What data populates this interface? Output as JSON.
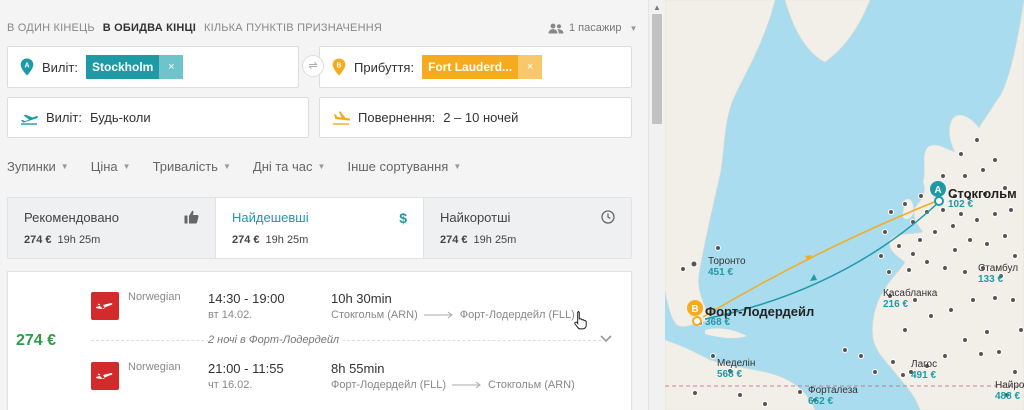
{
  "search": {
    "trip_types": [
      "В ОДИН КІНЕЦЬ",
      "В ОБИДВА КІНЦІ",
      "КІЛЬКА ПУНКТІВ ПРИЗНАЧЕННЯ"
    ],
    "passengers": "1 пасажир",
    "from_label": "Виліт:",
    "from_value": "Stockholm",
    "to_label": "Прибуття:",
    "to_value": "Fort Lauderd...",
    "depart_label": "Виліт:",
    "depart_value": "Будь-коли",
    "return_label": "Повернення:",
    "return_value": "2 – 10 ночей",
    "swap_icon": "⇌",
    "remove_icon": "×"
  },
  "filters": [
    "Зупинки",
    "Ціна",
    "Тривалість",
    "Дні та час",
    "Інше сортування"
  ],
  "sort_tabs": [
    {
      "name": "Рекомендовано",
      "price": "274 €",
      "duration": "19h 25m",
      "icon": "thumbs-up-icon"
    },
    {
      "name": "Найдешевші",
      "price": "274 €",
      "duration": "19h 25m",
      "icon": "dollar-icon"
    },
    {
      "name": "Найкоротші",
      "price": "274 €",
      "duration": "19h 25m",
      "icon": "clock-icon"
    }
  ],
  "result": {
    "price": "274 €",
    "outbound": {
      "airline": "Norwegian",
      "times": "14:30 - 19:00",
      "date": "вт 14.02.",
      "duration": "10h 30min",
      "from": "Стокгольм (ARN)",
      "to": "Форт-Лодердейл (FLL)"
    },
    "stay": "2 ночі в Форт-Лодердейл",
    "inbound": {
      "airline": "Norwegian",
      "times": "21:00 - 11:55",
      "date": "чт 16.02.",
      "duration": "8h 55min",
      "from": "Форт-Лодердейл (FLL)",
      "to": "Стокгольм (ARN)"
    }
  },
  "map": {
    "cities": [
      {
        "name": "Стокгольм",
        "price": "102 €"
      },
      {
        "name": "Торонто",
        "price": "451 €"
      },
      {
        "name": "Стамбул",
        "price": "133 €"
      },
      {
        "name": "Касабланка",
        "price": "216 €"
      },
      {
        "name": "Форт-Лодердейл",
        "price": "368 €"
      },
      {
        "name": "Меделін",
        "price": "568 €"
      },
      {
        "name": "Лагос",
        "price": "491 €"
      },
      {
        "name": "Форталеза",
        "price": "662 €"
      },
      {
        "name": "Найро",
        "price": "488 €"
      }
    ],
    "marker_a": "A",
    "marker_b": "B"
  },
  "colors": {
    "accent": "#1e9aa6",
    "orange": "#f6ab1e",
    "price_green": "#2d9d45",
    "airline_red": "#d32b2b",
    "ocean": "#a9dcee",
    "land": "#f2efe9"
  }
}
